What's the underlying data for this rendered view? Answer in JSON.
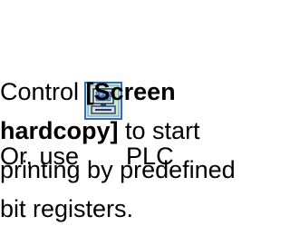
{
  "paragraph": {
    "line1": {
      "before_icon": "Or, use",
      "after_icon": "PLC"
    },
    "line2": {
      "text": "Control ",
      "bold": "[Screen"
    },
    "line3": {
      "bold": "hardcopy]",
      "text": " to start"
    },
    "line4": {
      "text": "printing by predefined"
    },
    "line5": {
      "text": "bit registers."
    }
  },
  "icon": {
    "name": "plc-control-icon",
    "frame_color": "#2d6fb8",
    "fill_color": "#cfe8c8"
  }
}
